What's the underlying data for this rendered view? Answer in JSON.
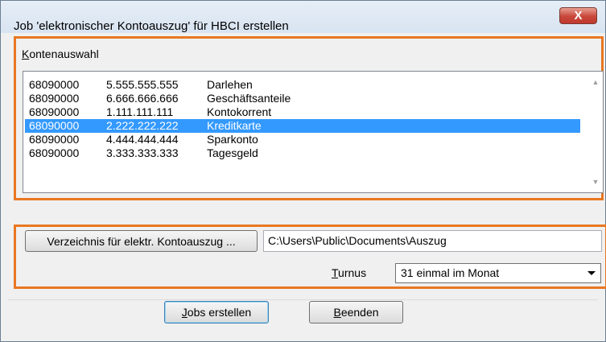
{
  "window": {
    "title": "Job 'elektronischer Kontoauszug' für HBCI erstellen",
    "close_label": "X"
  },
  "accounts": {
    "group_label": "Kontenauswahl",
    "rows": [
      {
        "blz": "68090000",
        "number": "5.555.555.555",
        "name": "Darlehen",
        "selected": false
      },
      {
        "blz": "68090000",
        "number": "6.666.666.666",
        "name": "Geschäftsanteile",
        "selected": false
      },
      {
        "blz": "68090000",
        "number": "1.111.111.111",
        "name": "Kontokorrent",
        "selected": false
      },
      {
        "blz": "68090000",
        "number": "2.222.222.222",
        "name": "Kreditkarte",
        "selected": true
      },
      {
        "blz": "68090000",
        "number": "4.444.444.444",
        "name": "Sparkonto",
        "selected": false
      },
      {
        "blz": "68090000",
        "number": "3.333.333.333",
        "name": "Tagesgeld",
        "selected": false
      }
    ]
  },
  "directory": {
    "button_label": "Verzeichnis für elektr. Kontoauszug ...",
    "path_value": "C:\\Users\\Public\\Documents\\Auszug"
  },
  "turnus": {
    "label": "Turnus",
    "selected": "31 einmal im Monat"
  },
  "actions": {
    "create_label": "Jobs erstellen",
    "quit_label": "Beenden"
  },
  "colors": {
    "highlight": "#e87722",
    "selection": "#3399ff"
  }
}
